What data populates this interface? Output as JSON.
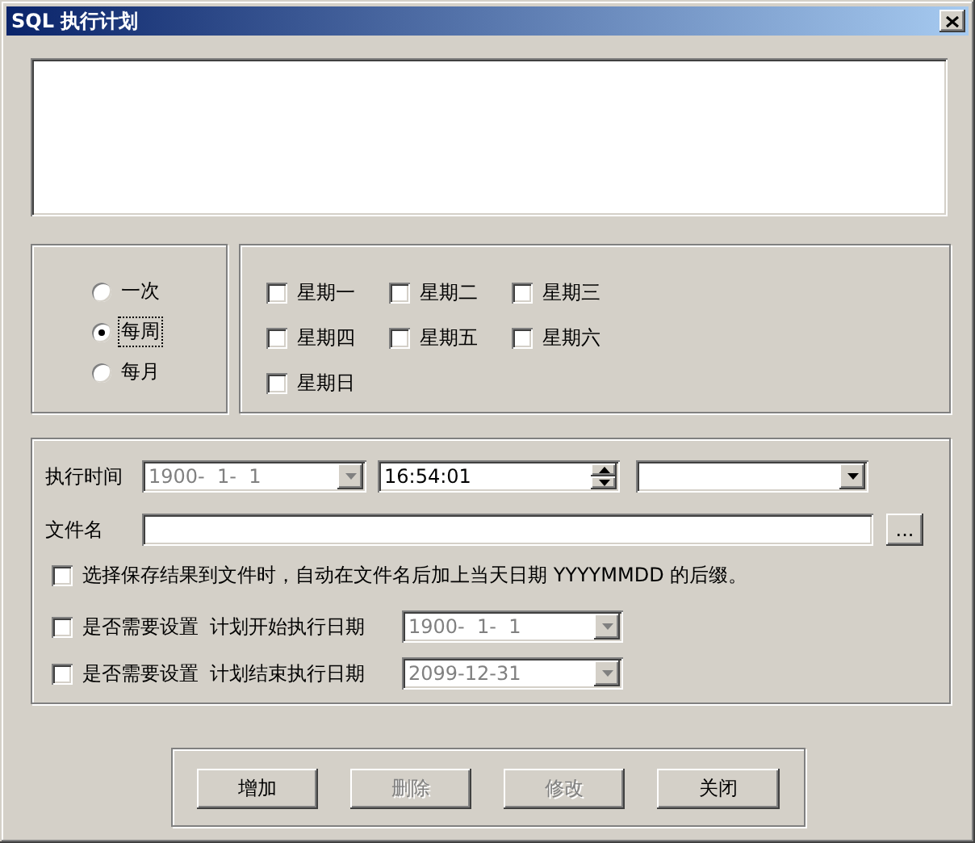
{
  "window": {
    "title": "SQL 执行计划"
  },
  "frequency": [
    {
      "label": "一次",
      "selected": false
    },
    {
      "label": "每周",
      "selected": true
    },
    {
      "label": "每月",
      "selected": false
    }
  ],
  "weekdays": [
    {
      "label": "星期一",
      "checked": false
    },
    {
      "label": "星期二",
      "checked": false
    },
    {
      "label": "星期三",
      "checked": false
    },
    {
      "label": "星期四",
      "checked": false
    },
    {
      "label": "星期五",
      "checked": false
    },
    {
      "label": "星期六",
      "checked": false
    },
    {
      "label": "星期日",
      "checked": false
    }
  ],
  "execution_time": {
    "label": "执行时间",
    "date": {
      "value": "1900-  1-  1",
      "disabled": true
    },
    "time": {
      "value": "16:54:01"
    }
  },
  "file_name": {
    "label": "文件名",
    "browse_button": "..."
  },
  "append_date": {
    "label": "选择保存结果到文件时，自动在文件名后加上当天日期 YYYYMMDD 的后缀。",
    "checked": false
  },
  "date_ranges": [
    {
      "label": "是否需要设置",
      "checked": false,
      "caption": "计划开始执行日期",
      "value": "1900-  1-  1",
      "disabled": true
    },
    {
      "label": "是否需要设置",
      "checked": false,
      "caption": "计划结束执行日期",
      "value": "2099-12-31",
      "disabled": true
    }
  ],
  "buttons": [
    {
      "label": "增加",
      "disabled": false
    },
    {
      "label": "删除",
      "disabled": true
    },
    {
      "label": "修改",
      "disabled": true
    },
    {
      "label": "关闭",
      "disabled": false
    }
  ]
}
